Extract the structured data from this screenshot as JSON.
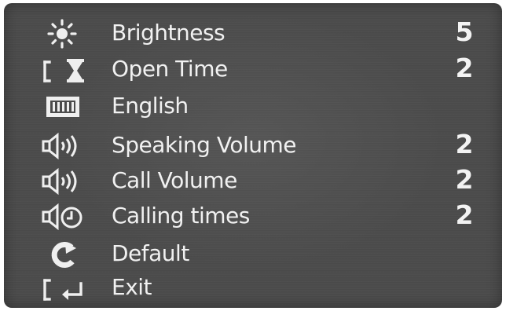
{
  "menu": {
    "items": [
      {
        "icon": "brightness-sun-icon",
        "label": "Brightness",
        "value": "5"
      },
      {
        "icon": "hourglass-icon",
        "label": "Open Time",
        "value": "2"
      },
      {
        "icon": "language-keyboard-icon",
        "label": "English",
        "value": ""
      },
      {
        "icon": "speaker-volume-icon",
        "label": "Speaking Volume",
        "value": "2"
      },
      {
        "icon": "speaker-volume-icon",
        "label": "Call Volume",
        "value": "2"
      },
      {
        "icon": "speaker-timer-icon",
        "label": "Calling times",
        "value": "2"
      },
      {
        "icon": "reset-refresh-icon",
        "label": "Default",
        "value": ""
      },
      {
        "icon": "return-enter-icon",
        "label": "Exit",
        "value": ""
      }
    ]
  },
  "colors": {
    "screen_bg": "#4b4b4b",
    "text": "#f1f1f1"
  }
}
